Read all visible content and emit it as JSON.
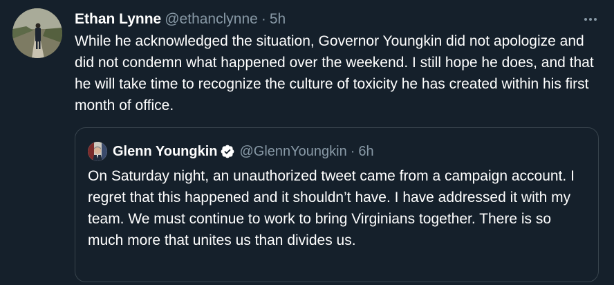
{
  "tweet": {
    "author_name": "Ethan Lynne",
    "handle": "@ethanclynne",
    "separator": "·",
    "time": "5h",
    "text": "While he acknowledged the situation, Governor Youngkin did not apologize and did not condemn what happened over the weekend. I still hope he does, and that he will take time to recognize the culture of toxicity he has created within his first month of office.",
    "more_icon": "more-horizontal-icon"
  },
  "quoted_tweet": {
    "author_name": "Glenn Youngkin",
    "verified_icon": "verified-badge-icon",
    "handle": "@GlennYoungkin",
    "separator": "·",
    "time": "6h",
    "text": "On Saturday night, an unauthorized tweet came from a campaign account. I regret that this happened and it shouldn’t have. I have addressed it with my team. We must continue to work to bring Virginians together. There is so much more that unites us than divides us."
  },
  "colors": {
    "background": "#15202b",
    "primary_text": "#ffffff",
    "secondary_text": "#8899a6",
    "border": "#38444d",
    "verified_blue": "#1d9bf0"
  }
}
